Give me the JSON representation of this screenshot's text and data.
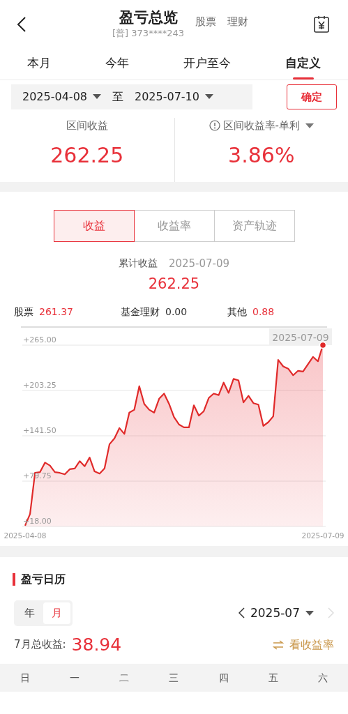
{
  "header": {
    "title": "盈亏总览",
    "account": "[普] 373****243",
    "links": [
      "股票",
      "理财"
    ]
  },
  "period_tabs": [
    {
      "label": "本月",
      "selected": false
    },
    {
      "label": "今年",
      "selected": false
    },
    {
      "label": "开户至今",
      "selected": false
    },
    {
      "label": "自定义",
      "selected": true
    }
  ],
  "date_range": {
    "start": "2025-04-08",
    "separator": "至",
    "end": "2025-07-10",
    "confirm": "确定"
  },
  "summary": [
    {
      "label": "区间收益",
      "value": "262.25"
    },
    {
      "label": "区间收益率-单利",
      "value": "3.86%",
      "info": true,
      "dropdown": true
    }
  ],
  "chart_tabs": [
    {
      "label": "收益",
      "selected": true
    },
    {
      "label": "收益率",
      "selected": false
    },
    {
      "label": "资产轨迹",
      "selected": false
    }
  ],
  "cumulative": {
    "label": "累计收益",
    "date": "2025-07-09",
    "value": "262.25"
  },
  "breakdown": [
    {
      "label": "股票",
      "value": "261.37",
      "color": "#e8313a"
    },
    {
      "label": "基金理财",
      "value": "0.00",
      "color": "#333333"
    },
    {
      "label": "其他",
      "value": "0.88",
      "color": "#e8313a"
    }
  ],
  "chart": {
    "tooltip": "2025-07-09",
    "chart_data": {
      "type": "area",
      "categories": [
        "2025-04-08",
        null,
        null,
        null,
        null,
        null,
        null,
        null,
        null,
        null,
        null,
        null,
        null,
        null,
        null,
        null,
        null,
        null,
        null,
        null,
        null,
        null,
        null,
        null,
        null,
        null,
        null,
        null,
        null,
        null,
        null,
        null,
        null,
        null,
        null,
        null,
        null,
        null,
        null,
        null,
        null,
        null,
        null,
        null,
        null,
        null,
        null,
        null,
        null,
        null,
        null,
        null,
        null,
        null,
        null,
        null,
        null,
        null,
        null,
        null,
        "2025-07-09"
      ],
      "ylim": [
        18,
        265
      ],
      "grid": true,
      "yticks": [
        {
          "value": 265,
          "label": "+265.00"
        },
        {
          "value": 203.25,
          "label": "+203.25"
        },
        {
          "value": 141.5,
          "label": "+141.50"
        },
        {
          "value": 79.75,
          "label": "+79.75"
        },
        {
          "value": 18,
          "label": "+18.00"
        }
      ],
      "series": [
        {
          "color": "#e02a2a",
          "values": [
            19,
            35,
            91,
            92,
            105,
            101,
            92,
            91,
            89,
            96,
            97,
            107,
            100,
            112,
            93,
            90,
            97,
            130,
            138,
            152,
            144,
            173,
            177,
            209,
            185,
            177,
            173,
            192,
            199,
            185,
            167,
            157,
            153,
            153,
            183,
            169,
            175,
            193,
            199,
            197,
            214,
            200,
            219,
            217,
            187,
            196,
            186,
            184,
            155,
            160,
            168,
            245,
            236,
            233,
            224,
            230,
            229,
            239,
            249,
            243,
            265
          ]
        }
      ]
    }
  },
  "calendar": {
    "title": "盈亏日历",
    "modes": [
      {
        "label": "年",
        "selected": false
      },
      {
        "label": "月",
        "selected": true
      }
    ],
    "month": "2025-07",
    "total_label": "7月总收益:",
    "total": "38.94",
    "toggle": "看收益率",
    "weekdays": [
      "日",
      "一",
      "二",
      "三",
      "四",
      "五",
      "六"
    ]
  }
}
